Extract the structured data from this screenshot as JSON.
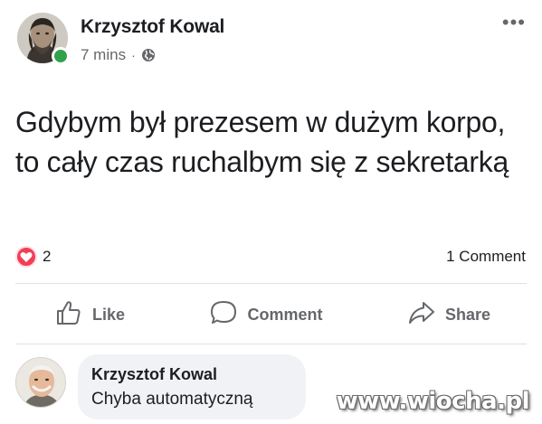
{
  "post": {
    "author": "Krzysztof Kowal",
    "time": "7 mins",
    "separator": "·",
    "privacy_icon": "globe-icon",
    "more_icon": "more-horizontal-icon",
    "more_label": "•••",
    "text": "Gdybym był prezesem w dużym korpo, to cały czas ruchalbym się z sekretarką",
    "online": true
  },
  "reactions": {
    "icon": "love-icon",
    "count": "2",
    "comments_label": "1 Comment"
  },
  "actions": {
    "like_label": "Like",
    "comment_label": "Comment",
    "share_label": "Share"
  },
  "comment": {
    "author": "Krzysztof Kowal",
    "text": "Chyba automatyczną"
  },
  "watermark": "www.wiocha.pl",
  "colors": {
    "online": "#31a24c",
    "love": "#f33e58",
    "muted": "#65676b",
    "bubble": "#f0f2f5"
  }
}
